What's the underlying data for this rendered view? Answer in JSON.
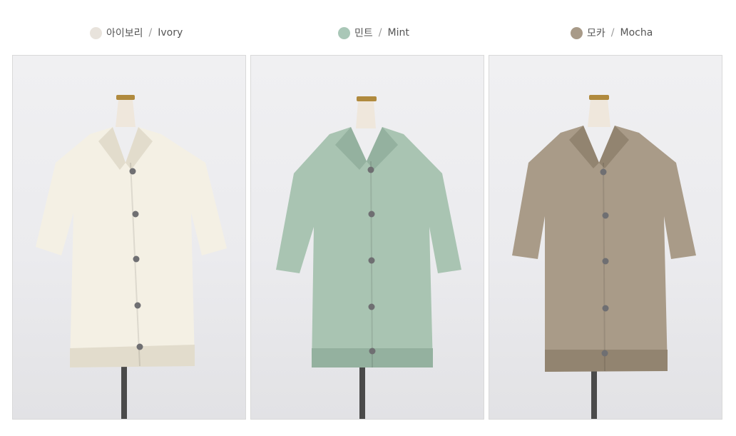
{
  "options": [
    {
      "korean": "아이보리",
      "slash": "/",
      "english": "Ivory",
      "color": "#e8e3dc",
      "garment": "#f4f0e4",
      "garment_shade": "#e2dccc"
    },
    {
      "korean": "민트",
      "slash": "/",
      "english": "Mint",
      "color": "#a9c7b7",
      "garment": "#a9c4b2",
      "garment_shade": "#94b19f"
    },
    {
      "korean": "모카",
      "slash": "/",
      "english": "Mocha",
      "color": "#a89a88",
      "garment": "#a99b88",
      "garment_shade": "#928470"
    }
  ]
}
